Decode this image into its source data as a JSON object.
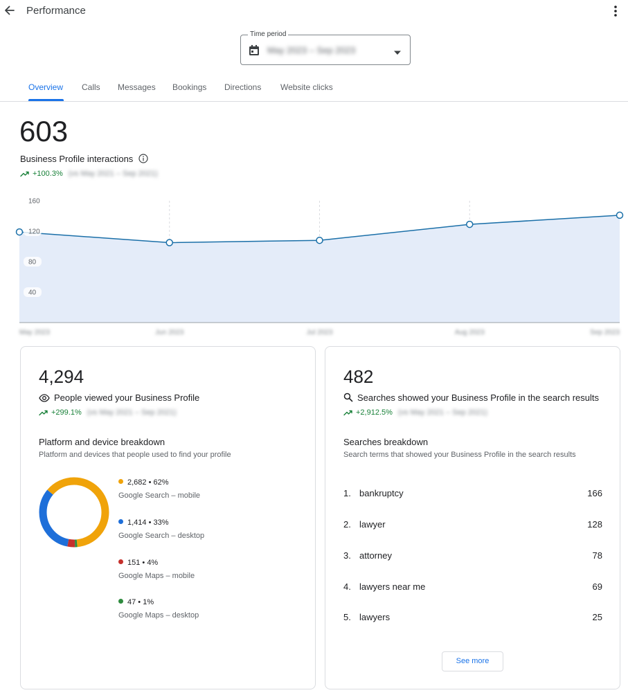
{
  "header": {
    "title": "Performance"
  },
  "time_period": {
    "label": "Time period",
    "value": "May 2023 – Sep 2023"
  },
  "tabs": [
    {
      "label": "Overview",
      "active": true
    },
    {
      "label": "Calls"
    },
    {
      "label": "Messages"
    },
    {
      "label": "Bookings"
    },
    {
      "label": "Directions"
    },
    {
      "label": "Website clicks"
    }
  ],
  "interactions": {
    "total": "603",
    "label": "Business Profile interactions",
    "change": "+100.3%",
    "comparison": "(vs May 2021 – Sep 2021)"
  },
  "chart_data": {
    "type": "area",
    "x": [
      "May 2023",
      "Jun 2023",
      "Jul 2023",
      "Aug 2023",
      "Sep 2023"
    ],
    "values": [
      119,
      105,
      108,
      129,
      141
    ],
    "ylim": [
      0,
      160
    ],
    "yticks": [
      "160",
      "120",
      "80",
      "40"
    ],
    "grid": "vertical dashed",
    "color": "#1a6fa8",
    "fill": "#e4ecf9"
  },
  "views_card": {
    "total": "4,294",
    "label": "People viewed your Business Profile",
    "change": "+299.1%",
    "comparison": "(vs May 2021 – Sep 2021)",
    "breakdown_title": "Platform and device breakdown",
    "breakdown_subtitle": "Platform and devices that people used to find your profile",
    "items": [
      {
        "value": "2,682 • 62%",
        "name": "Google Search – mobile",
        "count": 2682,
        "color": "#f0a30a"
      },
      {
        "value": "1,414 • 33%",
        "name": "Google Search – desktop",
        "count": 1414,
        "color": "#1e6fd9"
      },
      {
        "value": "151 • 4%",
        "name": "Google Maps – mobile",
        "count": 151,
        "color": "#c5302c"
      },
      {
        "value": "47 • 1%",
        "name": "Google Maps – desktop",
        "count": 47,
        "color": "#2e8b3e"
      }
    ]
  },
  "searches_card": {
    "total": "482",
    "label": "Searches showed your Business Profile in the search results",
    "change": "+2,912.5%",
    "comparison": "(vs May 2021 – Sep 2021)",
    "breakdown_title": "Searches breakdown",
    "breakdown_subtitle": "Search terms that showed your Business Profile in the search results",
    "terms": [
      {
        "rank": "1.",
        "term": "bankruptcy",
        "count": "166"
      },
      {
        "rank": "2.",
        "term": "lawyer",
        "count": "128"
      },
      {
        "rank": "3.",
        "term": "attorney",
        "count": "78"
      },
      {
        "rank": "4.",
        "term": "lawyers near me",
        "count": "69"
      },
      {
        "rank": "5.",
        "term": "lawyers",
        "count": "25"
      }
    ],
    "see_more_label": "See more"
  },
  "colors": {
    "accent": "#1a73e8",
    "positive": "#188038"
  }
}
